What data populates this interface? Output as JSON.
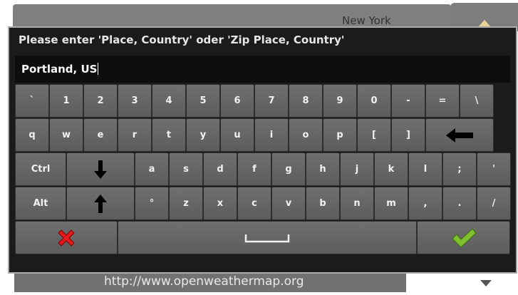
{
  "background": {
    "city": "New York",
    "url": "http://www.openweathermap.org",
    "up_icon": "up-arrow-icon",
    "down_icon": "down-arrow-icon"
  },
  "dialog": {
    "prompt": "Please enter 'Place, Country' oder 'Zip Place, Country'",
    "input_value": "Portland, US"
  },
  "keyboard": {
    "row1": [
      "`",
      "1",
      "2",
      "3",
      "4",
      "5",
      "6",
      "7",
      "8",
      "9",
      "0",
      "-",
      "=",
      "\\"
    ],
    "row2": [
      "q",
      "w",
      "e",
      "r",
      "t",
      "y",
      "u",
      "i",
      "o",
      "p",
      "[",
      "]"
    ],
    "row3": [
      "a",
      "s",
      "d",
      "f",
      "g",
      "h",
      "j",
      "k",
      "l",
      ";",
      "'"
    ],
    "row4": [
      "°",
      "z",
      "x",
      "c",
      "v",
      "b",
      "n",
      "m",
      ",",
      ".",
      "/"
    ],
    "ctrl_label": "Ctrl",
    "alt_label": "Alt",
    "icons": {
      "backspace": "left-arrow-icon",
      "shift_down": "down-arrow-icon",
      "shift_up": "up-arrow-icon",
      "cancel": "red-x-icon",
      "space": "space-bar-icon",
      "confirm": "green-check-icon"
    },
    "colors": {
      "cancel": "#e31a1a",
      "confirm": "#7dbf2c"
    }
  }
}
